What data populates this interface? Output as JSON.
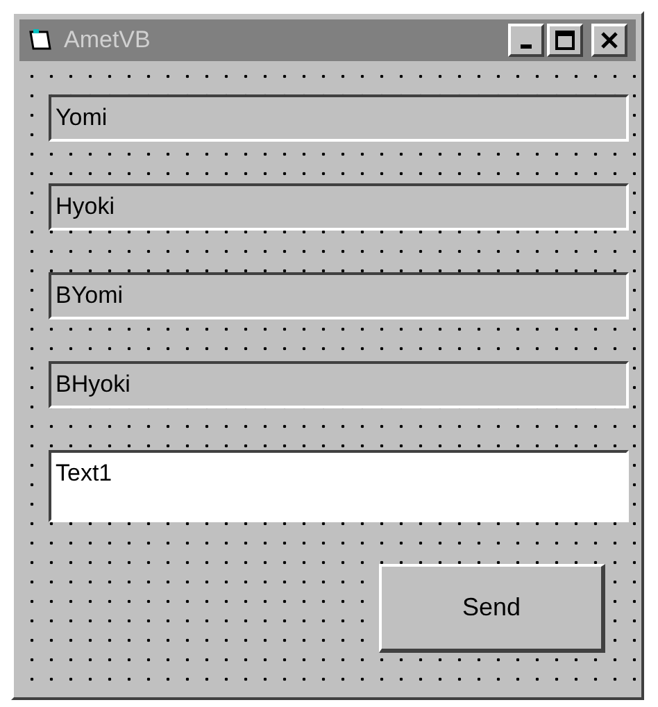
{
  "window": {
    "title": "AmetVB",
    "active": false
  },
  "fields": [
    {
      "value": "Yomi",
      "disabled": true
    },
    {
      "value": "Hyoki",
      "disabled": true
    },
    {
      "value": "BYomi",
      "disabled": true
    },
    {
      "value": "BHyoki",
      "disabled": true
    },
    {
      "value": "Text1",
      "disabled": false,
      "kind": "tall"
    }
  ],
  "button": {
    "label": "Send"
  }
}
